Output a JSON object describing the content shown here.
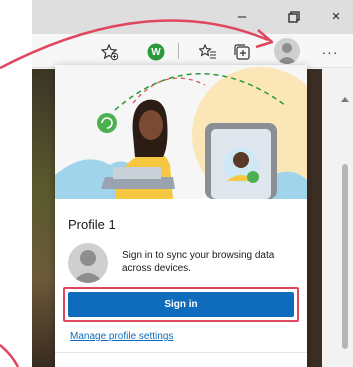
{
  "window_controls": {
    "minimize": "–",
    "restore": "🗗",
    "close": "×"
  },
  "toolbar": {
    "favorites_add_icon": "star-plus-icon",
    "extension_label": "W",
    "favorites_icon": "favorites-list-icon",
    "collections_icon": "collections-icon",
    "more_label": "···"
  },
  "flyout": {
    "profile_name": "Profile 1",
    "sync_prompt": "Sign in to sync your browsing data across devices.",
    "sign_in_label": "Sign in",
    "manage_label": "Manage profile settings"
  },
  "colors": {
    "accent": "#0f6cbd",
    "highlight": "#e0475e",
    "extension_green": "#2b9a3c"
  }
}
